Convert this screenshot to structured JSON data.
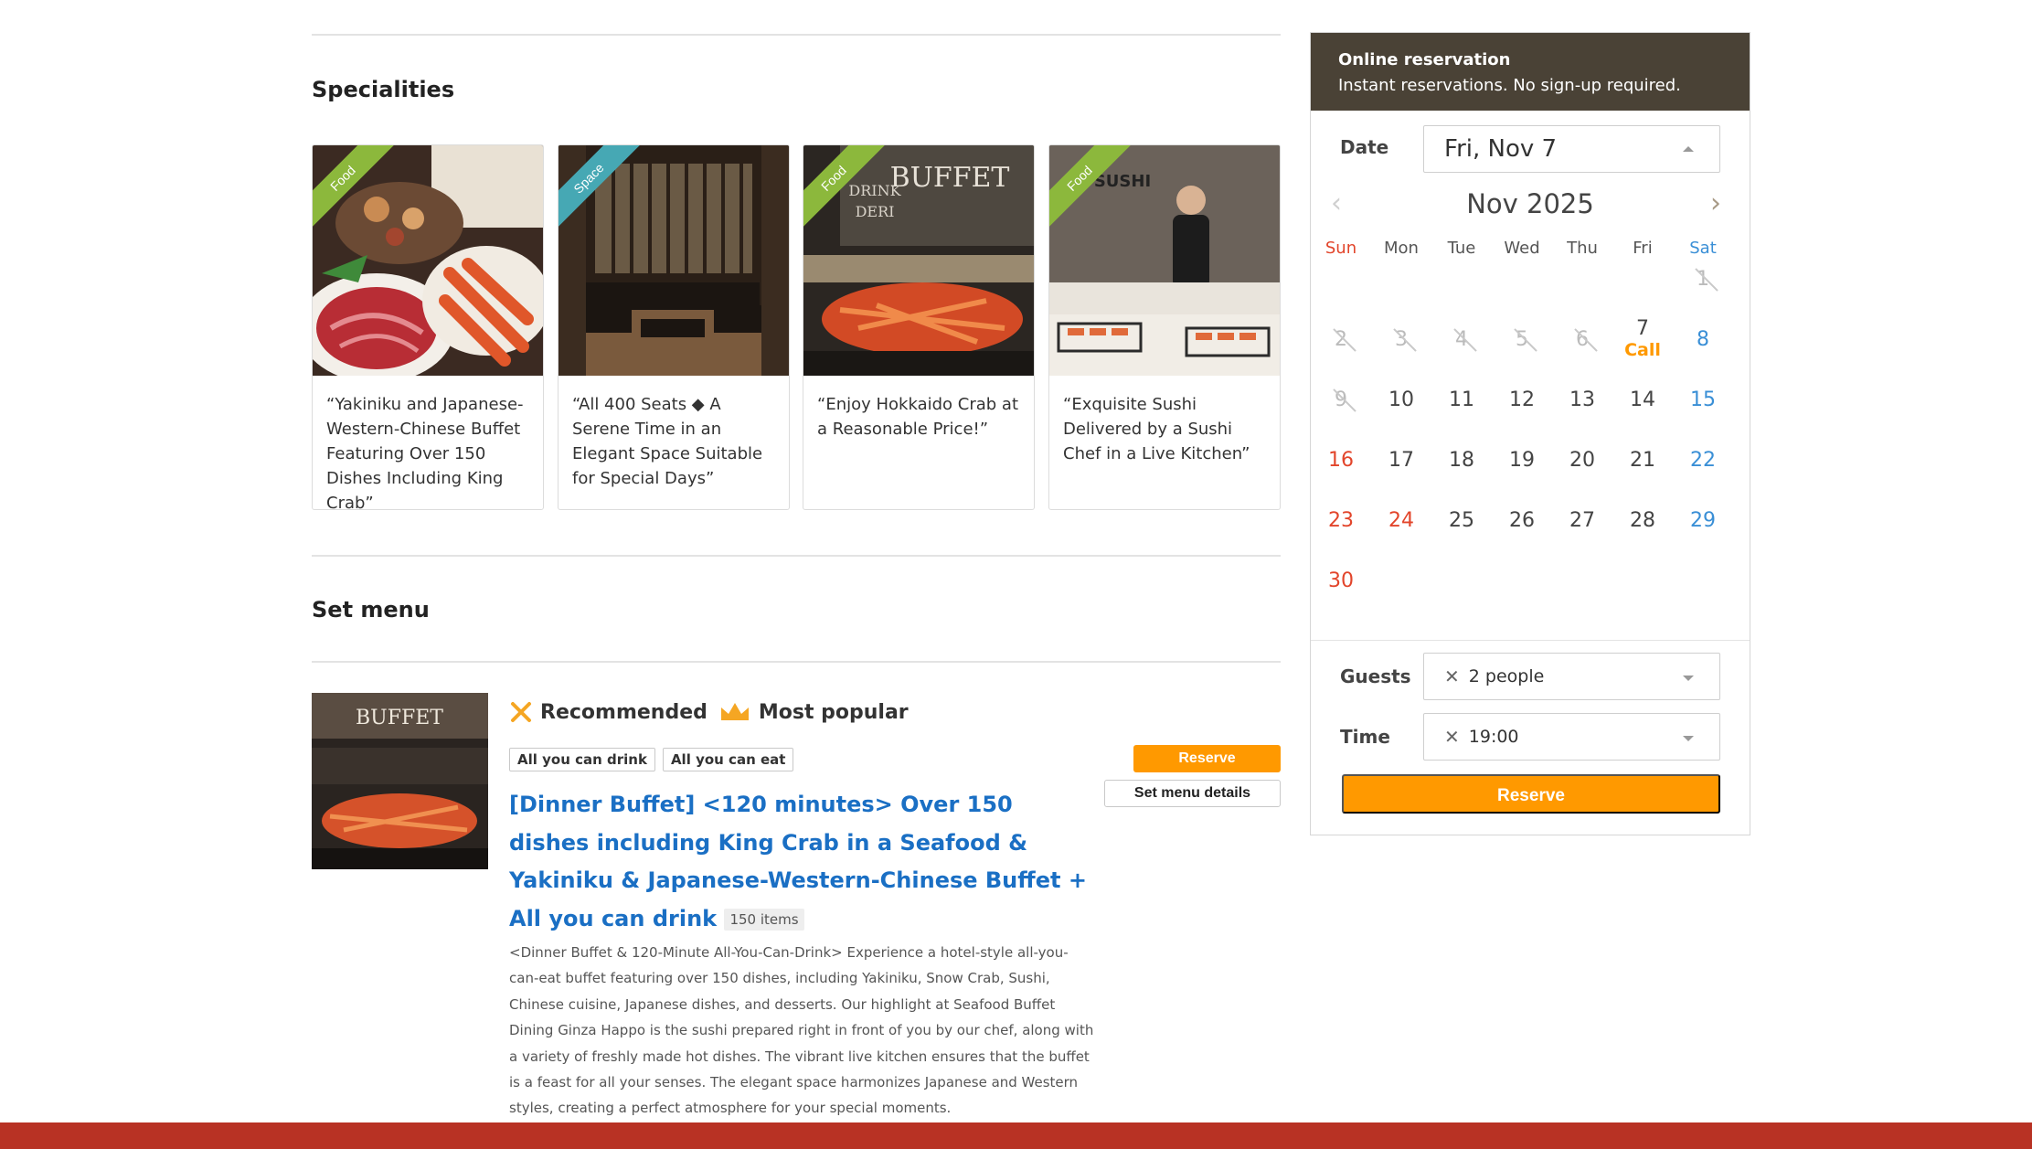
{
  "specialities": {
    "title": "Specialities",
    "cards": [
      {
        "tag": "Food",
        "tag_color": "#8cb83c",
        "text": "“Yakiniku and Japanese-Western-Chinese Buffet Featuring Over 150 Dishes Including King Crab”"
      },
      {
        "tag": "Space",
        "tag_color": "#46a8b4",
        "text": "“All 400 Seats ◆ A Serene Time in an Elegant Space Suitable for Special Days”"
      },
      {
        "tag": "Food",
        "tag_color": "#8cb83c",
        "text": "“Enjoy Hokkaido Crab at a Reasonable Price!”"
      },
      {
        "tag": "Food",
        "tag_color": "#8cb83c",
        "text": "“Exquisite Sushi Delivered by a Sushi Chef in a Live Kitchen”"
      }
    ]
  },
  "set_menu": {
    "title": "Set menu",
    "badges": {
      "recommended": "Recommended",
      "popular": "Most popular"
    },
    "tags": [
      "All you can drink",
      "All you can eat"
    ],
    "plan_title": "[Dinner Buffet] <120 minutes> Over 150 dishes including King Crab in a Seafood & Yakiniku & Japanese-Western-Chinese Buffet + All you can drink",
    "item_count": "150 items",
    "description": "<Dinner Buffet & 120-Minute All-You-Can-Drink> Experience a hotel-style all-you-can-eat buffet featuring over 150 dishes, including Yakiniku, Snow Crab, Sushi, Chinese cuisine, Japanese dishes, and desserts. Our highlight at Seafood Buffet Dining Ginza Happo is the sushi prepared right in front of you by our chef, along with a variety of freshly made hot dishes. The vibrant live kitchen ensures that the buffet is a feast for all your senses. The elegant space harmonizes Japanese and Western styles, creating a perfect atmosphere for your special moments.",
    "reserve_label": "Reserve",
    "details_label": "Set menu details",
    "thumb_sign": "BUFFET"
  },
  "reservation": {
    "header_title": "Online reservation",
    "header_subtitle": "Instant reservations. No sign-up required.",
    "date_label": "Date",
    "date_value": "Fri, Nov 7",
    "month_label": "Nov 2025",
    "weekdays": [
      "Sun",
      "Mon",
      "Tue",
      "Wed",
      "Thu",
      "Fri",
      "Sat"
    ],
    "call_label": "Call",
    "guests_label": "Guests",
    "guests_value": "2 people",
    "time_label": "Time",
    "time_value": "19:00",
    "reserve_label": "Reserve"
  },
  "images": {
    "card3_sign": "BUFFET",
    "card3_sign2": "DRINK",
    "card3_sign3": "DERI",
    "card4_sign": "SUSHI"
  },
  "colors": {
    "accent_orange": "#ff9900",
    "link_blue": "#1a6fc4",
    "header_brown": "#4a4236",
    "footer_red": "#b83224",
    "sunday_red": "#e2452b",
    "saturday_blue": "#3a8fd6"
  }
}
